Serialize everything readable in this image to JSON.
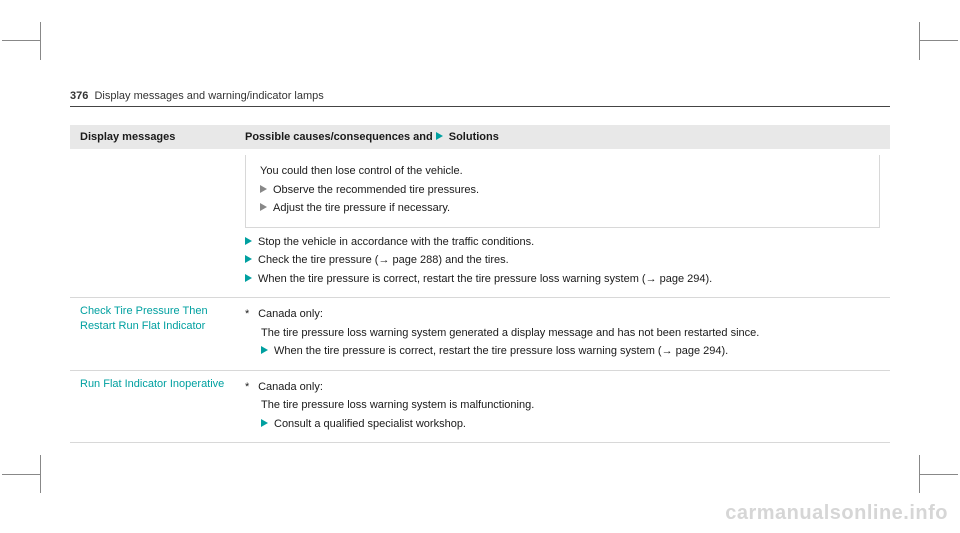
{
  "page_number": "376",
  "running_head": "Display messages and warning/indicator lamps",
  "headers": {
    "col1": "Display messages",
    "col2_a": "Possible causes/consequences and ",
    "col2_b": "Solutions"
  },
  "row1": {
    "display_msg": "",
    "notice_line1": "You could then lose control of the vehicle.",
    "notice_step1": "Observe the recommended tire pressures.",
    "notice_step2": "Adjust the tire pressure if necessary.",
    "step1": "Stop the vehicle in accordance with the traffic conditions.",
    "step2a": "Check the tire pressure (",
    "step2b": " page 288) and the tires.",
    "step3a": "When the tire pressure is correct, restart the tire pressure loss warning system (",
    "step3b": " page 294)."
  },
  "row2": {
    "display_msg": "Check Tire Pressure Then Restart Run Flat Indicator",
    "canada": "Canada only:",
    "body": "The tire pressure loss warning system generated a display message and has not been restarted since.",
    "step1a": "When the tire pressure is correct, restart the tire pressure loss warning system (",
    "step1b": " page 294)."
  },
  "row3": {
    "display_msg": "Run Flat Indicator Inoperative",
    "canada": "Canada only:",
    "body": "The tire pressure loss warning system is malfunctioning.",
    "step1": "Consult a qualified specialist workshop."
  },
  "watermark": "carmanualsonline.info"
}
